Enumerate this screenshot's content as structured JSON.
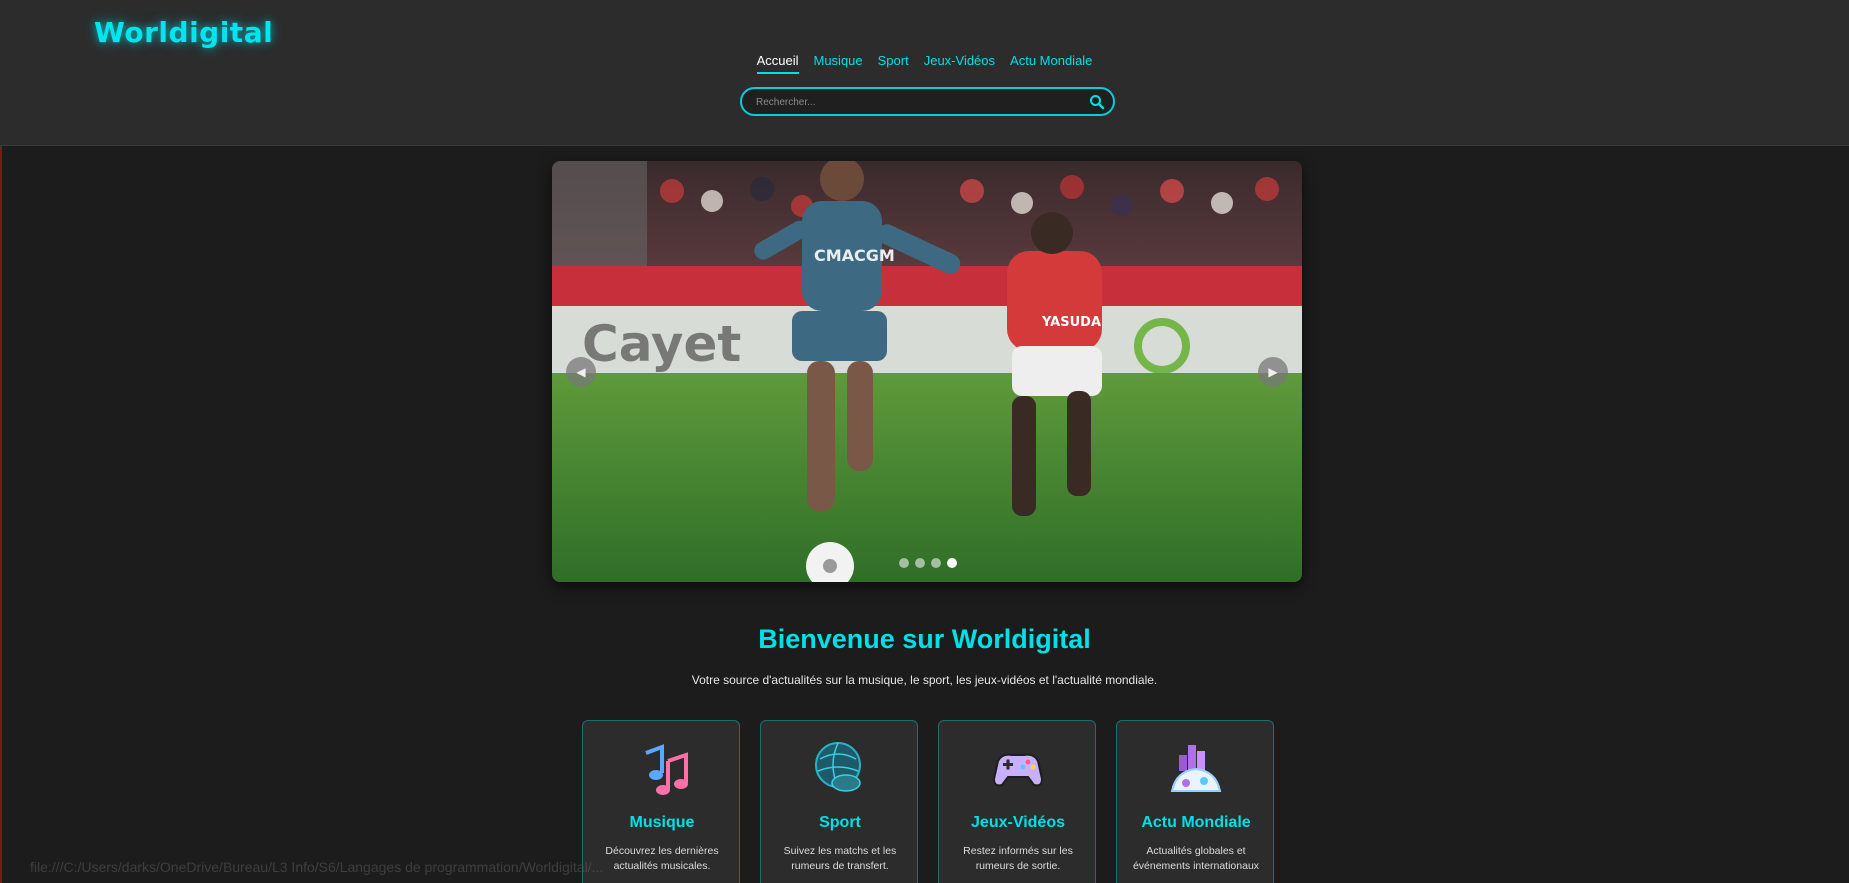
{
  "brand": {
    "name": "Worldigital",
    "accent": "#00e0e8"
  },
  "nav": {
    "items": [
      {
        "label": "Accueil",
        "active": true
      },
      {
        "label": "Musique"
      },
      {
        "label": "Sport"
      },
      {
        "label": "Jeux-Vidéos"
      },
      {
        "label": "Actu Mondiale"
      }
    ]
  },
  "search": {
    "placeholder": "Rechercher...",
    "icon": "search-icon"
  },
  "carousel": {
    "slide_count": 4,
    "active_index": 4,
    "prev_symbol": "◀",
    "next_symbol": "▶",
    "image_text": {
      "jersey_left": "CMACGM",
      "jersey_right": "YASUDA",
      "banner": "Cayet"
    }
  },
  "welcome": {
    "title": "Bienvenue sur Worldigital",
    "subtitle": "Votre source d'actualités sur la musique, le sport, les jeux-vidéos et l'actualité mondiale."
  },
  "cards": [
    {
      "icon": "music-notes-icon",
      "title": "Musique",
      "desc": "Découvrez les dernières actualités musicales."
    },
    {
      "icon": "football-globe-icon",
      "title": "Sport",
      "desc": "Suivez les matchs et les rumeurs de transfert."
    },
    {
      "icon": "gamepad-icon",
      "title": "Jeux-Vidéos",
      "desc": "Restez informés sur les rumeurs de sortie."
    },
    {
      "icon": "world-news-icon",
      "title": "Actu Mondiale",
      "desc": "Actualités globales et événements internationaux"
    }
  ],
  "status_bar": {
    "url": "file:///C:/Users/darks/OneDrive/Bureau/L3 Info/S6/Langages de programmation/Worldigital/..."
  }
}
